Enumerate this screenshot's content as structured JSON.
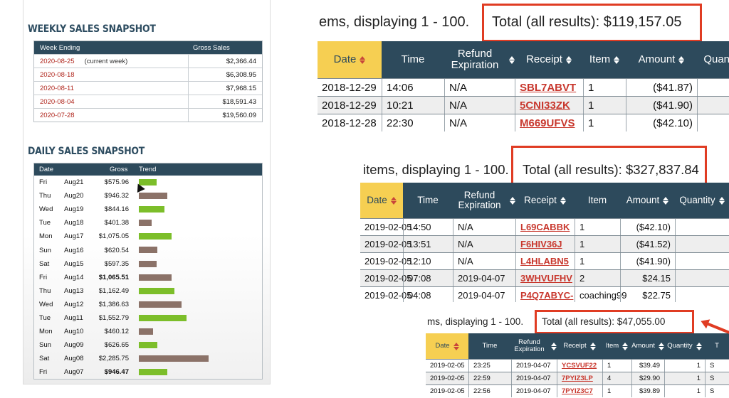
{
  "weekly": {
    "title": "WEEKLY SALES SNAPSHOT",
    "headers": [
      "Week Ending",
      "Gross Sales"
    ],
    "rows": [
      {
        "date": "2020-08-25",
        "note": "(current week)",
        "gross": "$2,366.44"
      },
      {
        "date": "2020-08-18",
        "note": "",
        "gross": "$6,308.95"
      },
      {
        "date": "2020-08-11",
        "note": "",
        "gross": "$7,968.15"
      },
      {
        "date": "2020-08-04",
        "note": "",
        "gross": "$18,591.43"
      },
      {
        "date": "2020-07-28",
        "note": "",
        "gross": "$19,560.09"
      }
    ]
  },
  "daily": {
    "title": "DAILY SALES SNAPSHOT",
    "headers": [
      "Date",
      "Gross",
      "Trend"
    ],
    "rows": [
      {
        "day": "Fri",
        "date": "Aug21",
        "gross": "$575.96",
        "trend": "up",
        "bar": 0.25,
        "bold": false
      },
      {
        "day": "Thu",
        "date": "Aug20",
        "gross": "$946.32",
        "trend": "down",
        "bar": 0.41,
        "bold": false
      },
      {
        "day": "Wed",
        "date": "Aug19",
        "gross": "$844.16",
        "trend": "up",
        "bar": 0.37,
        "bold": false
      },
      {
        "day": "Tue",
        "date": "Aug18",
        "gross": "$401.38",
        "trend": "down",
        "bar": 0.18,
        "bold": false
      },
      {
        "day": "Mon",
        "date": "Aug17",
        "gross": "$1,075.05",
        "trend": "up",
        "bar": 0.47,
        "bold": false
      },
      {
        "day": "Sun",
        "date": "Aug16",
        "gross": "$620.54",
        "trend": "down",
        "bar": 0.27,
        "bold": false
      },
      {
        "day": "Sat",
        "date": "Aug15",
        "gross": "$597.35",
        "trend": "down",
        "bar": 0.26,
        "bold": false
      },
      {
        "day": "Fri",
        "date": "Aug14",
        "gross": "$1,065.51",
        "trend": "down",
        "bar": 0.47,
        "bold": true
      },
      {
        "day": "Thu",
        "date": "Aug13",
        "gross": "$1,162.49",
        "trend": "up",
        "bar": 0.51,
        "bold": false
      },
      {
        "day": "Wed",
        "date": "Aug12",
        "gross": "$1,386.63",
        "trend": "down",
        "bar": 0.61,
        "bold": false
      },
      {
        "day": "Tue",
        "date": "Aug11",
        "gross": "$1,552.79",
        "trend": "up",
        "bar": 0.68,
        "bold": false
      },
      {
        "day": "Mon",
        "date": "Aug10",
        "gross": "$460.12",
        "trend": "down",
        "bar": 0.2,
        "bold": false
      },
      {
        "day": "Sun",
        "date": "Aug09",
        "gross": "$626.65",
        "trend": "up",
        "bar": 0.27,
        "bold": false
      },
      {
        "day": "Sat",
        "date": "Aug08",
        "gross": "$2,285.75",
        "trend": "down",
        "bar": 1.0,
        "bold": false
      },
      {
        "day": "Fri",
        "date": "Aug07",
        "gross": "$946.47",
        "trend": "up",
        "bar": 0.41,
        "bold": true
      }
    ]
  },
  "grids": [
    {
      "status": "ems, displaying 1 - 100.",
      "total": "Total (all results): $119,157.05",
      "columns": [
        "Date",
        "Time",
        "Refund Expiration",
        "Receipt",
        "Item",
        "Amount",
        "Quantit"
      ],
      "rows": [
        [
          "2018-12-29",
          "14:06",
          "N/A",
          "SBL7ABVT",
          "1",
          "($41.87)",
          ""
        ],
        [
          "2018-12-29",
          "10:21",
          "N/A",
          "5CNI33ZK",
          "1",
          "($41.90)",
          ""
        ],
        [
          "2018-12-28",
          "22:30",
          "N/A",
          "M669UFVS",
          "1",
          "($42.10)",
          ""
        ]
      ]
    },
    {
      "status": "items, displaying 1 - 100.",
      "total": "Total (all results): $327,837.84",
      "columns": [
        "Date",
        "Time",
        "Refund Expiration",
        "Receipt",
        "Item",
        "Amount",
        "Quantity"
      ],
      "rows": [
        [
          "2019-02-05",
          "14:50",
          "N/A",
          "L69CABBK",
          "1",
          "($42.10)",
          ""
        ],
        [
          "2019-02-05",
          "13:51",
          "N/A",
          "F6HIV36J",
          "1",
          "($41.52)",
          ""
        ],
        [
          "2019-02-05",
          "12:10",
          "N/A",
          "L4HLABN5",
          "1",
          "($41.90)",
          ""
        ],
        [
          "2019-02-05",
          "07:08",
          "2019-04-07",
          "3WHVUFHV",
          "2",
          "$24.15",
          ""
        ],
        [
          "2019-02-05",
          "04:08",
          "2019-04-07",
          "P4Q7ABYC-",
          "coaching99",
          "$22.75",
          ""
        ]
      ]
    },
    {
      "status": "ms, displaying 1 - 100.",
      "total": "Total (all results): $47,055.00",
      "columns": [
        "Date",
        "Time",
        "Refund Expiration",
        "Receipt",
        "Item",
        "Amount",
        "Quantity",
        "T"
      ],
      "rows": [
        [
          "2019-02-05",
          "23:25",
          "2019-04-07",
          "YCSVUF22",
          "1",
          "$39.49",
          "1",
          "S"
        ],
        [
          "2019-02-05",
          "22:59",
          "2019-04-07",
          "7PYIZ3LP",
          "4",
          "$29.90",
          "1",
          "S"
        ],
        [
          "2019-02-05",
          "22:56",
          "2019-04-07",
          "7PYIZ3C7",
          "1",
          "$39.89",
          "1",
          "S"
        ]
      ]
    }
  ],
  "colors": {
    "accent": "#e03c23",
    "header": "#2d4a5c",
    "date_header": "#f6cf52",
    "link": "#c8372d",
    "trend_up": "#7cbe2a",
    "trend_down": "#8b7268"
  }
}
